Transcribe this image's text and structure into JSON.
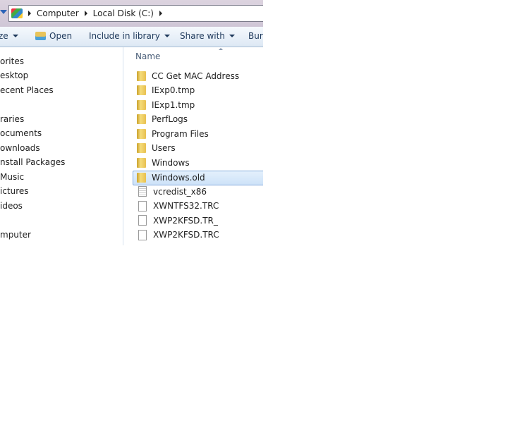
{
  "address": {
    "crumbs": [
      "Computer",
      "Local Disk (C:)"
    ]
  },
  "toolbar": {
    "organize": "ze",
    "open": "Open",
    "include": "Include in library",
    "share": "Share with",
    "burn": "Burn"
  },
  "nav": [
    "orites",
    "esktop",
    "ecent Places",
    "raries",
    "ocuments",
    "ownloads",
    "nstall Packages",
    "Music",
    "ictures",
    "ideos",
    "mputer"
  ],
  "list": {
    "header": "Name",
    "items": [
      {
        "name": "CC Get MAC Address",
        "type": "folder"
      },
      {
        "name": "IExp0.tmp",
        "type": "folder"
      },
      {
        "name": "IExp1.tmp",
        "type": "folder"
      },
      {
        "name": "PerfLogs",
        "type": "folder"
      },
      {
        "name": "Program Files",
        "type": "folder"
      },
      {
        "name": "Users",
        "type": "folder"
      },
      {
        "name": "Windows",
        "type": "folder"
      },
      {
        "name": "Windows.old",
        "type": "folder",
        "selected": true
      },
      {
        "name": "vcredist_x86",
        "type": "document"
      },
      {
        "name": "XWNTFS32.TRC",
        "type": "file"
      },
      {
        "name": "XWP2KFSD.TR_",
        "type": "file"
      },
      {
        "name": "XWP2KFSD.TRC",
        "type": "file"
      }
    ]
  }
}
